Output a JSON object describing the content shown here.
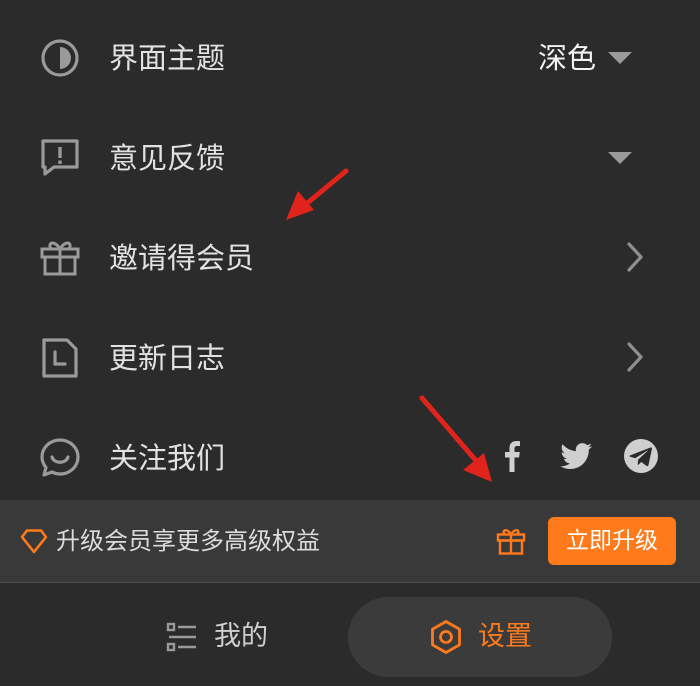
{
  "colors": {
    "background": "#2b2b2b",
    "accent": "#ff7a1a",
    "icon_gray": "#9a9a9a",
    "text_primary": "#e2e2e2",
    "annotation_red": "#e0241b"
  },
  "menu": {
    "theme": {
      "label": "界面主题",
      "value": "深色",
      "icon": "half-circle-icon"
    },
    "feedback": {
      "label": "意见反馈",
      "icon": "feedback-icon"
    },
    "invite": {
      "label": "邀请得会员",
      "icon": "gift-icon"
    },
    "changelog": {
      "label": "更新日志",
      "icon": "document-clock-icon"
    },
    "follow": {
      "label": "关注我们",
      "icon": "chat-smile-icon",
      "socials": [
        "facebook-icon",
        "twitter-icon",
        "telegram-icon"
      ]
    }
  },
  "promo": {
    "text": "升级会员享更多高级权益",
    "button_label": "立即升级"
  },
  "tabbar": {
    "mine_label": "我的",
    "settings_label": "设置",
    "active_tab": "设置"
  }
}
